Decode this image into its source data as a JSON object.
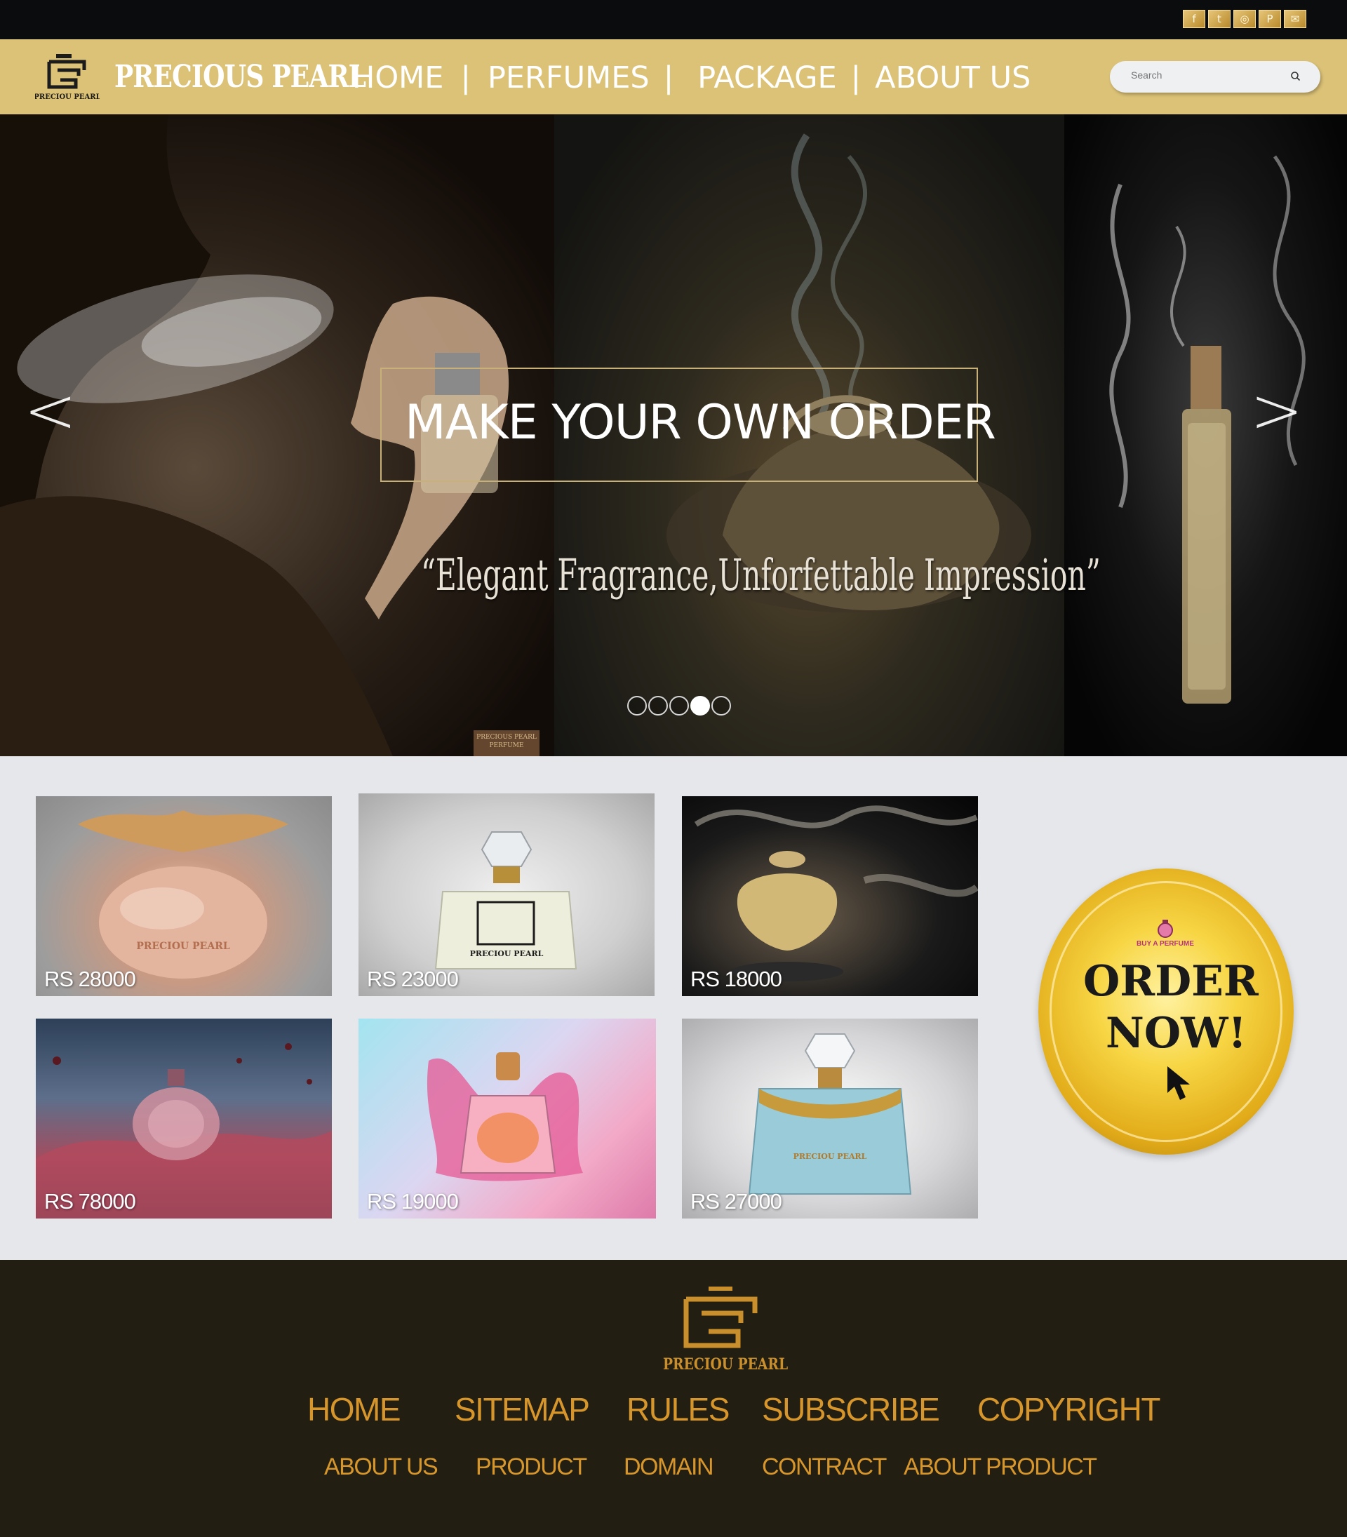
{
  "social": {
    "icons": [
      "facebook-icon",
      "twitter-icon",
      "instagram-icon",
      "pinterest-icon",
      "email-icon"
    ]
  },
  "header": {
    "brand": "PRECIOUS PEARL",
    "nav": {
      "home": "HOME",
      "perfumes": "PERFUMES",
      "package": "PACKAGE",
      "about": "ABOUT US",
      "separator": "|"
    },
    "search": {
      "placeholder": "Search"
    }
  },
  "hero": {
    "prev": "<",
    "next": ">",
    "cta": "MAKE YOUR OWN ORDER",
    "tagline": "“Elegant Fragrance,Unforfettable Impression”",
    "slides": {
      "count": 5,
      "active_index": 3
    },
    "watermark": "PRECIOUS PEARL PERFUME"
  },
  "products": {
    "items": [
      {
        "price": "RS 28000"
      },
      {
        "price": "RS 23000"
      },
      {
        "price": "RS 18000"
      },
      {
        "price": "RS 78000"
      },
      {
        "price": "RS 19000"
      },
      {
        "price": "RS 27000"
      }
    ],
    "order_button": {
      "small_label": "BUY A PERFUME",
      "line1": "ORDER",
      "line2": "NOW!"
    }
  },
  "footer": {
    "brand": "PRECIOU PEARL",
    "row1": [
      "HOME",
      "SITEMAP",
      "RULES",
      "SUBSCRIBE",
      "COPYRIGHT"
    ],
    "row2": [
      "ABOUT US",
      "PRODUCT",
      "DOMAIN",
      "CONTRACT",
      "ABOUT PRODUCT"
    ]
  },
  "colors": {
    "header_gold": "#dcc277",
    "footer_bg": "#221e11",
    "footer_link": "#d6962c",
    "products_bg": "#e5e7ea"
  }
}
